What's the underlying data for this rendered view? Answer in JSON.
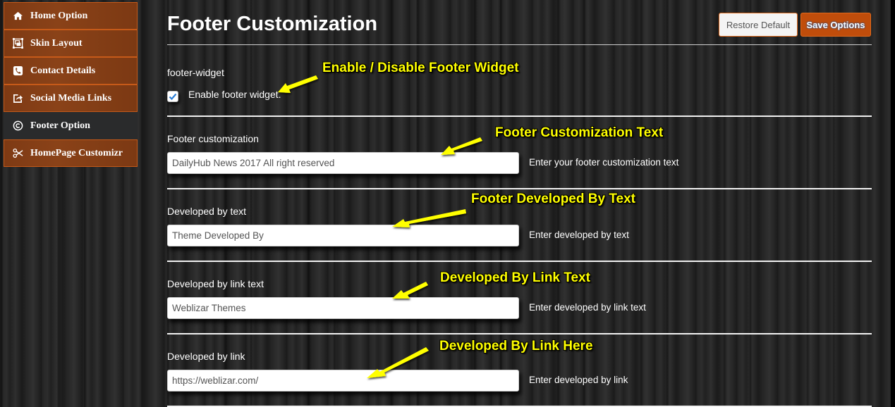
{
  "sidebar": {
    "items": [
      {
        "label": "Home Option",
        "icon": "home-icon",
        "active": false
      },
      {
        "label": "Skin Layout",
        "icon": "layout-icon",
        "active": false
      },
      {
        "label": "Contact Details",
        "icon": "phone-icon",
        "active": false
      },
      {
        "label": "Social Media Links",
        "icon": "share-icon",
        "active": false
      },
      {
        "label": "Footer Option",
        "icon": "copyright-icon",
        "active": true
      },
      {
        "label": "HomePage Customizr",
        "icon": "scissors-icon",
        "active": false
      }
    ]
  },
  "header": {
    "title": "Footer Customization",
    "restore_label": "Restore Default",
    "save_label": "Save Options"
  },
  "sections": {
    "widget": {
      "label": "footer-widget",
      "checkbox_label": "Enable footer widget.",
      "checked": true
    },
    "footer_custom": {
      "label": "Footer customization",
      "value": "DailyHub News 2017 All right reserved",
      "hint": "Enter your footer customization text"
    },
    "dev_text": {
      "label": "Developed by text",
      "value": "Theme Developed By",
      "hint": "Enter developed by text"
    },
    "dev_link_text": {
      "label": "Developed by link text",
      "value": "Weblizar Themes",
      "hint": "Enter developed by link text"
    },
    "dev_link": {
      "label": "Developed by link",
      "value": "https://weblizar.com/",
      "hint": "Enter developed by link"
    }
  },
  "annotations": {
    "widget": "Enable / Disable Footer Widget",
    "footer_custom": "Footer Customization Text",
    "dev_text": "Footer Developed By Text",
    "dev_link_text": "Developed By Link Text",
    "dev_link": "Developed By Link Here"
  },
  "colors": {
    "accent": "#c04d0b",
    "sidebar_item": "#843f16",
    "sidebar_active": "#2a2b2c",
    "annotation": "#ffff00"
  }
}
